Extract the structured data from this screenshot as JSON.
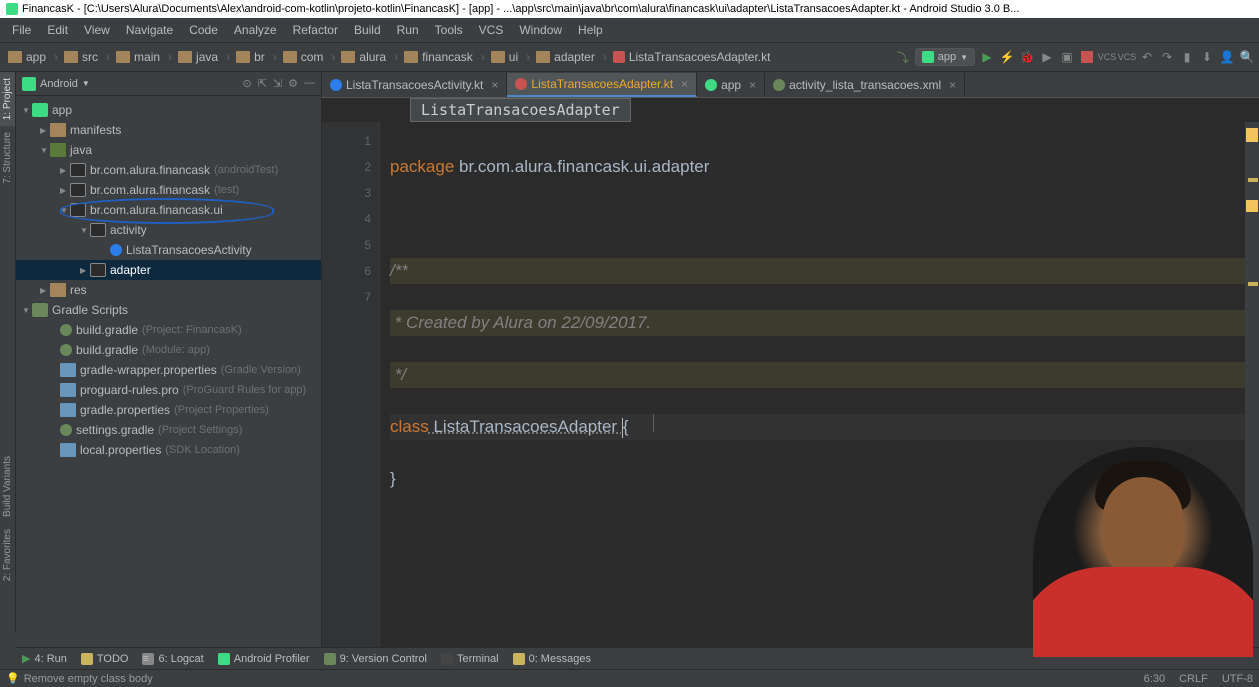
{
  "title": "FinancasK - [C:\\Users\\Alura\\Documents\\Alex\\android-com-kotlin\\projeto-kotlin\\FinancasK] - [app] - ...\\app\\src\\main\\java\\br\\com\\alura\\financask\\ui\\adapter\\ListaTransacoesAdapter.kt - Android Studio 3.0 B...",
  "menu": [
    "File",
    "Edit",
    "View",
    "Navigate",
    "Code",
    "Analyze",
    "Refactor",
    "Build",
    "Run",
    "Tools",
    "VCS",
    "Window",
    "Help"
  ],
  "breadcrumbs": [
    "app",
    "src",
    "main",
    "java",
    "br",
    "com",
    "alura",
    "financask",
    "ui",
    "adapter",
    "ListaTransacoesAdapter.kt"
  ],
  "run_config": "app",
  "project_view": "Android",
  "tree": {
    "app": "app",
    "manifests": "manifests",
    "java": "java",
    "pkg_at": "br.com.alura.financask",
    "pkg_at_hint": "(androidTest)",
    "pkg_test": "br.com.alura.financask",
    "pkg_test_hint": "(test)",
    "pkg_ui": "br.com.alura.financask.ui",
    "activity": "activity",
    "lista_activity": "ListaTransacoesActivity",
    "adapter": "adapter",
    "res": "res",
    "gradle_scripts": "Gradle Scripts",
    "build_gradle_proj": "build.gradle",
    "build_gradle_proj_hint": "(Project: FinancasK)",
    "build_gradle_app": "build.gradle",
    "build_gradle_app_hint": "(Module: app)",
    "gradle_wrapper": "gradle-wrapper.properties",
    "gradle_wrapper_hint": "(Gradle Version)",
    "proguard": "proguard-rules.pro",
    "proguard_hint": "(ProGuard Rules for app)",
    "gradle_props": "gradle.properties",
    "gradle_props_hint": "(Project Properties)",
    "settings_gradle": "settings.gradle",
    "settings_gradle_hint": "(Project Settings)",
    "local_props": "local.properties",
    "local_props_hint": "(SDK Location)"
  },
  "editor_tabs": [
    {
      "name": "ListaTransacoesActivity.kt",
      "icon": "kt",
      "active": false
    },
    {
      "name": "ListaTransacoesAdapter.kt",
      "icon": "kt2",
      "active": true
    },
    {
      "name": "app",
      "icon": "android",
      "active": false
    },
    {
      "name": "activity_lista_transacoes.xml",
      "icon": "xml",
      "active": false
    }
  ],
  "crumb_badge": "ListaTransacoesAdapter",
  "code": {
    "l1": "package br.com.alura.financask.ui.adapter",
    "l1_kw": "package",
    "l1_rest": " br.com.alura.financask.ui.adapter",
    "l3": "/**",
    "l4": " * Created by Alura on 22/09/2017.",
    "l5": " */",
    "l6_kw": "class",
    "l6_name": " ListaTransacoesAdapter ",
    "l6_brace": "{",
    "l7": "}"
  },
  "line_numbers": [
    "1",
    "2",
    "3",
    "4",
    "5",
    "6",
    "7"
  ],
  "bottom_tools": {
    "run": "4: Run",
    "todo": "TODO",
    "logcat": "6: Logcat",
    "profiler": "Android Profiler",
    "vcs": "9: Version Control",
    "terminal": "Terminal",
    "messages": "0: Messages"
  },
  "status": {
    "hint": "Remove empty class body",
    "pos": "6:30",
    "line_sep": "CRLF",
    "encoding": "UTF-8"
  },
  "edge_tabs": [
    "1: Project",
    "7: Structure",
    "Build Variants",
    "2: Favorites"
  ]
}
